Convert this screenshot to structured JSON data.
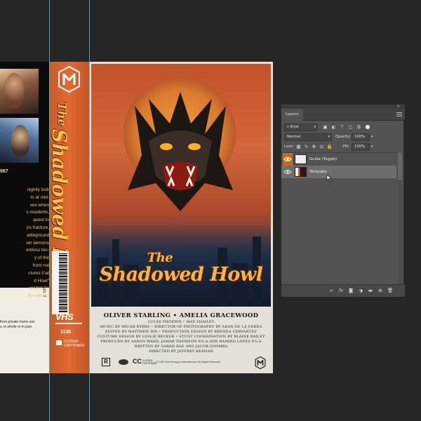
{
  "back_cover": {
    "year": "987",
    "synopsis_lines": [
      "nightly lock",
      "ts at mid-",
      "ues when",
      "s residents,",
      "quest to",
      "ps fracture,",
      "attleground",
      "wn demons",
      "entless ten-",
      "y of the",
      "front not",
      "ctures that",
      "d Howl\"",
      "onstrosity,",
      "the streets"
    ],
    "legal_lines": [
      "from private home use",
      "s, in whole or in part."
    ]
  },
  "spine": {
    "title_the": "The",
    "title_main": "Shadowed Howl",
    "barcode_digits": "0 85391 15193 7",
    "format": "VHS",
    "catalog_number": "1130",
    "cc_line1": "CLOSED",
    "cc_line2": "CAPTIONED"
  },
  "front_cover": {
    "title_the": "The",
    "title_main": "Shadowed Howl",
    "cast_line": "OLIVER STARLING • AMELIA GRACEWOOD",
    "cast_line2": "LUCAS PHOENIX • MAX SHAILEY",
    "credit_lines": [
      "MUSIC BY MICAH BYERS • DIRECTOR OF PHOTOGRAPHY BY ADAN DE LA CERDA",
      "EDITED BY MATTHEW DIX • PRODUCTION DESIGN BY BRENDA CERVANTEZ",
      "COSTUME DESIGN BY LESLIE BECKER • STUNT COORDINATION BY BLAINE BAILEY",
      "PRODUCED BY AARON WARD, JAMAR THOMSON P.G.A AND RAMIRO LOPEZ P.G.A",
      "WRITTEN BY SARAH RAE AND JACOB GOOMBA",
      "DIRECTED BY JEFFREY KEENAN"
    ],
    "rating": "R",
    "cc_badge": "CC",
    "cc_small": "CLOSED CAPTIONED",
    "copyright": "© 1987 Wolf Scrappy Entertainment. All Rights Reserved."
  },
  "layers_panel": {
    "tab_label": "Layers",
    "filter_kind": "Kind",
    "blend_mode": "Normal",
    "opacity_label": "Opacity:",
    "opacity_value": "100%",
    "lock_label": "Lock:",
    "fill_label": "Fill:",
    "fill_value": "100%",
    "layers": [
      {
        "name": "Guide (Toggle)",
        "visible": true,
        "selected": false,
        "thumb": "transparent"
      },
      {
        "name": "Template",
        "visible": true,
        "selected": true,
        "thumb": "template"
      }
    ],
    "bottom_icons": [
      "link-layers-icon",
      "fx-icon",
      "mask-icon",
      "adjustment-icon",
      "group-icon",
      "new-layer-icon",
      "trash-icon"
    ],
    "fx_label": "fx"
  },
  "colors": {
    "canvas": "#262626",
    "spine_orange": "#e06a32",
    "title_gold": "#f2b548",
    "panel_bg": "#535353",
    "selection": "#6d6d6d",
    "guide": "#3fb8c8",
    "eye_highlight": "#c56c1c"
  }
}
